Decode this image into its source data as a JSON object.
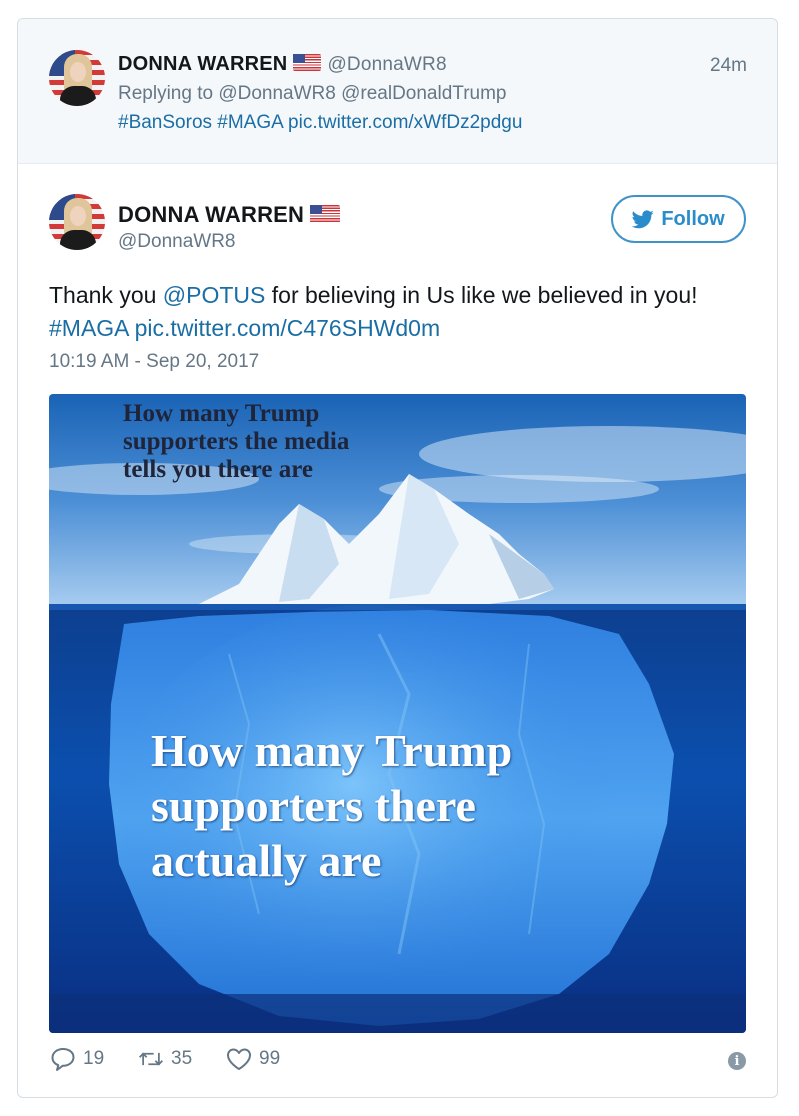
{
  "parent_tweet": {
    "display_name": "DONNA WARREN",
    "handle": "@DonnaWR8",
    "time_ago": "24m",
    "replying_to": "Replying to @DonnaWR8 @realDonaldTrump",
    "text": "#BanSoros #MAGA pic.twitter.com/xWfDz2pdgu"
  },
  "main_tweet": {
    "display_name": "DONNA WARREN",
    "handle": "@DonnaWR8",
    "follow_label": "Follow",
    "text_before": "Thank you ",
    "mention": "@POTUS",
    "text_after": " for believing in Us like we believed in you!",
    "hashtag_link": "#MAGA pic.twitter.com/C476SHWd0m",
    "timestamp": "10:19 AM - Sep 20, 2017"
  },
  "media": {
    "caption_top": "How many Trump\nsupporters the media\ntells you there are",
    "caption_main": "How many Trump\nsupporters there\nactually are"
  },
  "actions": {
    "replies": "19",
    "retweets": "35",
    "likes": "99",
    "info": "i"
  },
  "colors": {
    "link": "#1b6ea5",
    "follow_accent": "#2b8ccb",
    "muted": "#657786",
    "parent_bg": "#f5f8fa"
  },
  "icons": [
    "avatar",
    "us-flag-icon",
    "twitter-bird-icon",
    "reply-icon",
    "retweet-icon",
    "like-icon",
    "info-icon"
  ]
}
